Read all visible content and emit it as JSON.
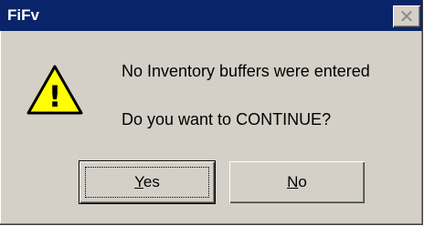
{
  "window": {
    "title": "FiFv",
    "close_glyph": "✕",
    "titlebar_color": "#0a246a",
    "face_color": "#d4d0c8"
  },
  "dialog": {
    "icon": "warning-exclamation-icon",
    "icon_glyph": "!",
    "icon_color": "#ffff00",
    "message_line_1": "No Inventory buffers were entered",
    "message_line_2": "Do you want to CONTINUE?"
  },
  "buttons": {
    "yes": {
      "hotkey": "Y",
      "rest": "es",
      "focused": true
    },
    "no": {
      "hotkey": "N",
      "rest": "o",
      "focused": false
    }
  }
}
